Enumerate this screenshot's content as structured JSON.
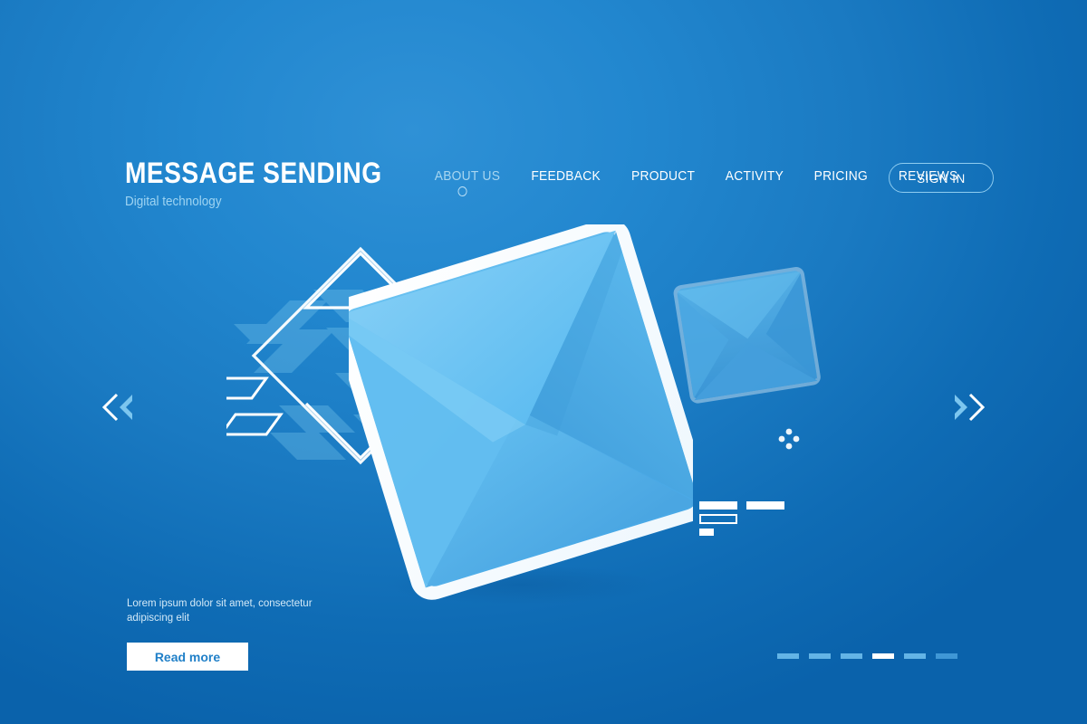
{
  "brand": {
    "title": "MESSAGE SENDING",
    "subtitle": "Digital technology"
  },
  "nav": {
    "items": [
      {
        "label": "ABOUT US",
        "active": true
      },
      {
        "label": "FEEDBACK",
        "active": false
      },
      {
        "label": "PRODUCT",
        "active": false
      },
      {
        "label": "ACTIVITY",
        "active": false
      },
      {
        "label": "PRICING",
        "active": false
      },
      {
        "label": "REVIEWS",
        "active": false
      }
    ],
    "signin_label": "SIGN IN"
  },
  "carousel": {
    "prev_label": "Previous slide",
    "next_label": "Next slide",
    "dots": [
      {
        "state": "inactive"
      },
      {
        "state": "inactive"
      },
      {
        "state": "inactive"
      },
      {
        "state": "active"
      },
      {
        "state": "inactive"
      },
      {
        "state": "faint"
      }
    ]
  },
  "copy": {
    "body": "Lorem ipsum dolor sit amet, consectetur adipiscing elit",
    "cta_label": "Read more"
  },
  "illustration": {
    "main_envelope": "envelope-3d-large",
    "small_envelope": "envelope-3d-small",
    "decor_diamond": "diamond-outline",
    "decor_dots": "four-dot-diamond",
    "decor_bars": "stacked-bars"
  },
  "colors": {
    "bg_light": "#2f91d6",
    "bg_dark": "#0a62ab",
    "envelope_face": "#5dbdf2",
    "envelope_shade": "#4aa8e0",
    "envelope_border": "#ffffff",
    "accent_text": "#9ed4f2",
    "cta_text": "#2180c8"
  }
}
